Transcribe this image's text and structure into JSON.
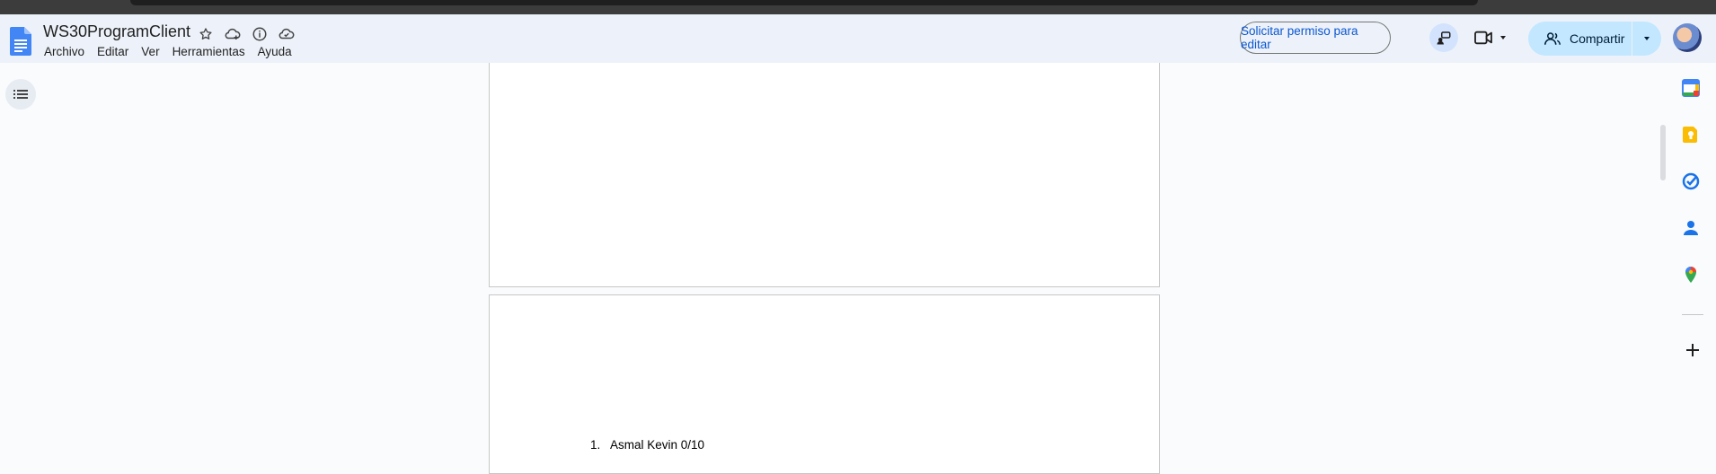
{
  "doc": {
    "title": "WS30ProgramClient"
  },
  "menu": [
    "Archivo",
    "Editar",
    "Ver",
    "Herramientas",
    "Ayuda"
  ],
  "actions": {
    "request_edit": "Solicitar permiso para editar",
    "share": "Compartir"
  },
  "content": {
    "list_items": [
      {
        "number": "1.",
        "text": "Asmal  Kevin 0/10"
      }
    ]
  },
  "colors": {
    "accent": "#0b57d0",
    "share_bg": "#c2e7ff",
    "header_bg": "#edf2fa"
  },
  "icons": {
    "side_panel": [
      "calendar-icon",
      "keep-icon",
      "tasks-icon",
      "contacts-icon",
      "maps-icon",
      "add-icon"
    ]
  }
}
